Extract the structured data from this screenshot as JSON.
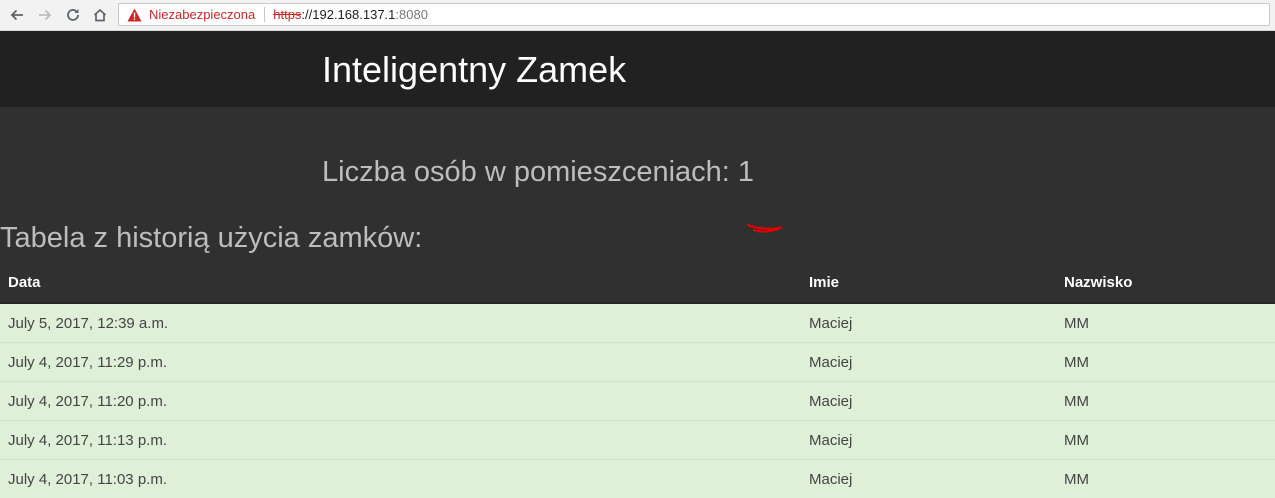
{
  "browser": {
    "security_label": "Niezabezpieczona",
    "url_scheme": "https",
    "url_host": "://192.168.137.1",
    "url_port": ":8080"
  },
  "header": {
    "title": "Inteligentny Zamek"
  },
  "main": {
    "people_count_label": "Liczba osób w pomieszceniach: 1",
    "history_title": "Tabela z historią użycia zamków:",
    "table": {
      "headers": [
        "Data",
        "Imie",
        "Nazwisko"
      ],
      "rows": [
        [
          "July 5, 2017, 12:39 a.m.",
          "Maciej",
          "MM"
        ],
        [
          "July 4, 2017, 11:29 p.m.",
          "Maciej",
          "MM"
        ],
        [
          "July 4, 2017, 11:20 p.m.",
          "Maciej",
          "MM"
        ],
        [
          "July 4, 2017, 11:13 p.m.",
          "Maciej",
          "MM"
        ],
        [
          "July 4, 2017, 11:03 p.m.",
          "Maciej",
          "MM"
        ]
      ]
    }
  },
  "colors": {
    "header_bg": "#212121",
    "page_bg": "#303030",
    "row_bg": "#dff0d8",
    "insecure_red": "#c62828"
  }
}
